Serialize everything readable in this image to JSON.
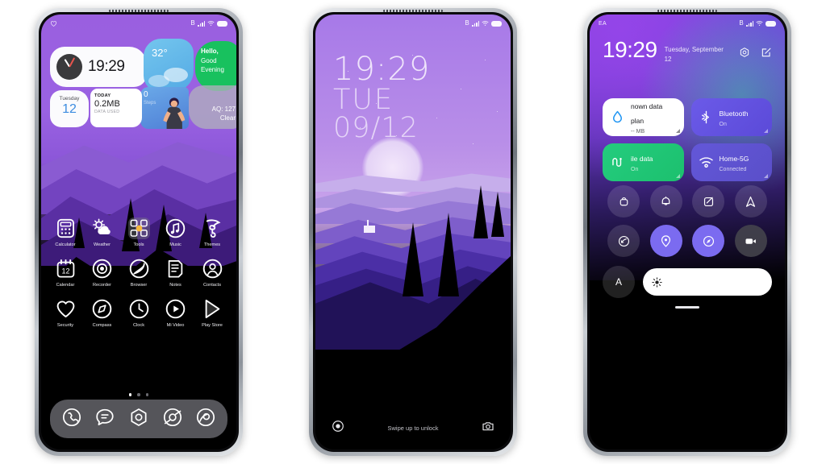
{
  "phone1": {
    "name": "home-screen",
    "statusbar": {
      "left_icon": "heart-icon",
      "bluetooth": "B",
      "battery": "battery-icon"
    },
    "widgets": {
      "clock": {
        "time": "19:29"
      },
      "weather": {
        "temp": "32°"
      },
      "greeting": {
        "line1": "Hello,",
        "line2": "Good",
        "line3": "Evening"
      },
      "calendar": {
        "weekday": "Tuesday",
        "day": "12"
      },
      "data": {
        "label": "TODAY",
        "value": "0.2MB",
        "sub": "DATA USED"
      },
      "steps": {
        "count": "0",
        "label": "Steps"
      },
      "air": {
        "line1": "AQ: 127",
        "line2": "Clear"
      }
    },
    "apps": [
      [
        {
          "label": "Calculator",
          "icon": "calculator-icon"
        },
        {
          "label": "Weather",
          "icon": "weather-icon"
        },
        {
          "label": "Tools",
          "icon": "tools-icon"
        },
        {
          "label": "Music",
          "icon": "music-icon"
        },
        {
          "label": "Themes",
          "icon": "themes-icon"
        }
      ],
      [
        {
          "label": "Calendar",
          "icon": "calendar-icon"
        },
        {
          "label": "Recorder",
          "icon": "recorder-icon"
        },
        {
          "label": "Browser",
          "icon": "browser-icon"
        },
        {
          "label": "Notes",
          "icon": "notes-icon"
        },
        {
          "label": "Contacts",
          "icon": "contacts-icon"
        }
      ],
      [
        {
          "label": "Security",
          "icon": "security-icon"
        },
        {
          "label": "Compass",
          "icon": "compass-icon"
        },
        {
          "label": "Clock",
          "icon": "clock-icon"
        },
        {
          "label": "Mi Video",
          "icon": "mi-video-icon"
        },
        {
          "label": "Play Store",
          "icon": "play-store-icon"
        }
      ]
    ],
    "pages": {
      "count": 3,
      "active": 1
    },
    "dock": [
      "phone-icon",
      "messages-icon",
      "settings-icon",
      "camera-icon",
      "gallery-icon"
    ]
  },
  "phone2": {
    "name": "lock-screen",
    "time": "19:29",
    "weekday": "TUE",
    "date": "09/12",
    "hint": "Swipe up to unlock",
    "left_shortcut": "flashlight-icon",
    "right_shortcut": "camera-icon"
  },
  "phone3": {
    "name": "control-center",
    "statusbar": {
      "carrier": "EA",
      "bluetooth": "B"
    },
    "time": "19:29",
    "date": "Tuesday, September 12",
    "actions": [
      "settings-icon",
      "edit-icon"
    ],
    "tiles": [
      {
        "title": "nown data plan",
        "sub": "-- MB",
        "icon": "water-drop-icon",
        "style": "light"
      },
      {
        "title": "Bluetooth",
        "sub": "On",
        "icon": "bluetooth-icon",
        "style": "blue"
      },
      {
        "title": "ile data",
        "sub": "On",
        "icon": "mobile-data-icon",
        "style": "green"
      },
      {
        "title": "Home-5G",
        "sub": "Connected",
        "icon": "wifi-icon",
        "style": "blue2"
      }
    ],
    "toggles": [
      {
        "name": "auto-rotate-icon",
        "state": "off"
      },
      {
        "name": "sound-icon",
        "state": "off"
      },
      {
        "name": "screenshot-icon",
        "state": "off"
      },
      {
        "name": "airplane-icon",
        "state": "off"
      },
      {
        "name": "sync-icon",
        "state": "off"
      },
      {
        "name": "location-icon",
        "state": "on"
      },
      {
        "name": "scanner-icon",
        "state": "on"
      },
      {
        "name": "screen-record-icon",
        "state": "dark"
      }
    ],
    "brightness": {
      "auto_label": "A",
      "icon": "sun-icon",
      "value": 100
    }
  },
  "colors": {
    "accent_purple": "#8b41dd",
    "green_tile": "#24cc7e",
    "blue_tile": "#6b5ae8",
    "active_toggle": "#7b6bf0",
    "page_bg": "#ffffff"
  }
}
